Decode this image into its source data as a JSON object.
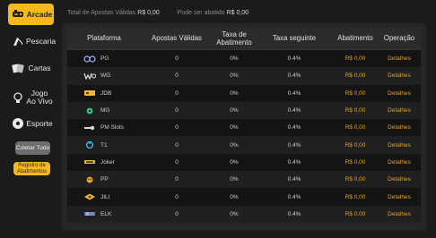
{
  "sidebar": {
    "items": [
      {
        "label": "Arcade",
        "icon": "arcade-icon",
        "active": true
      },
      {
        "label": "Pescaria",
        "icon": "fishing-icon",
        "active": false
      },
      {
        "label": "Cartas",
        "icon": "cards-icon",
        "active": false
      },
      {
        "label": "Jogo Ao Vivo",
        "icon": "live-game-icon",
        "active": false
      },
      {
        "label": "Esporte",
        "icon": "soccer-ball-icon",
        "active": false
      }
    ],
    "collect_button": "Coletar Tudo",
    "registro_button": "Registro de Abatimentos"
  },
  "summary": {
    "total_label": "Total de Apostas Válidas",
    "total_value": "R$ 0,00",
    "abatido_label": "Pode ser abatido",
    "abatido_value": "R$ 0,00"
  },
  "table": {
    "headers": [
      "Plataforma",
      "Apostas Válidas",
      "Taxa de Abatimento",
      "Taxa seguinte",
      "Abatimento",
      "Operação"
    ],
    "rows": [
      {
        "platform": "PG",
        "apostas": "0",
        "taxa": "0%",
        "seguinte": "0.4%",
        "abatimento": "R$ 0,00",
        "operacao": "Detalhes"
      },
      {
        "platform": "WG",
        "apostas": "0",
        "taxa": "0%",
        "seguinte": "0.4%",
        "abatimento": "R$ 0,00",
        "operacao": "Detalhes"
      },
      {
        "platform": "JDB",
        "apostas": "0",
        "taxa": "0%",
        "seguinte": "0.4%",
        "abatimento": "R$ 0,00",
        "operacao": "Detalhes"
      },
      {
        "platform": "MG",
        "apostas": "0",
        "taxa": "0%",
        "seguinte": "0.4%",
        "abatimento": "R$ 0,00",
        "operacao": "Detalhes"
      },
      {
        "platform": "PM Slots",
        "apostas": "0",
        "taxa": "0%",
        "seguinte": "0.4%",
        "abatimento": "R$ 0,00",
        "operacao": "Detalhes"
      },
      {
        "platform": "T1",
        "apostas": "0",
        "taxa": "0%",
        "seguinte": "0.4%",
        "abatimento": "R$ 0,00",
        "operacao": "Detalhes"
      },
      {
        "platform": "Joker",
        "apostas": "0",
        "taxa": "0%",
        "seguinte": "0.4%",
        "abatimento": "R$ 0,00",
        "operacao": "Detalhes"
      },
      {
        "platform": "PP",
        "apostas": "0",
        "taxa": "0%",
        "seguinte": "0.4%",
        "abatimento": "R$ 0,00",
        "operacao": "Detalhes"
      },
      {
        "platform": "JILI",
        "apostas": "0",
        "taxa": "0%",
        "seguinte": "0.4%",
        "abatimento": "R$ 0,00",
        "operacao": "Detalhes"
      },
      {
        "platform": "ELK",
        "apostas": "0",
        "taxa": "0%",
        "seguinte": "0.4%",
        "abatimento": "R$ 0,00",
        "operacao": "Detalhes"
      }
    ]
  },
  "colors": {
    "accent": "#f6b81d",
    "gold_text": "#e8a020",
    "background": "#1b1b1b"
  }
}
